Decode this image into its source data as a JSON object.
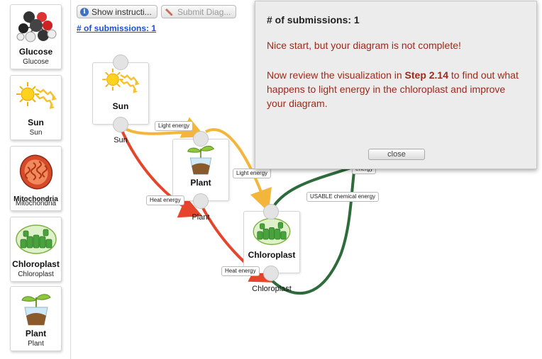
{
  "palette": {
    "items": [
      {
        "title": "Glucose",
        "subtitle": "Glucose"
      },
      {
        "title": "Sun",
        "subtitle": "Sun"
      },
      {
        "title": "Mitochondria",
        "subtitle": "Mitochondria"
      },
      {
        "title": "Chloroplast",
        "subtitle": "Chloroplast"
      },
      {
        "title": "Plant",
        "subtitle": "Plant"
      }
    ]
  },
  "toolbar": {
    "show_instructions_label": "Show instructi...",
    "submit_label": "Submit Diag...",
    "submissions_link": "# of submissions: 1"
  },
  "diagram": {
    "nodes": [
      {
        "title": "Sun",
        "caption": "Sun"
      },
      {
        "title": "Plant",
        "caption": "Plant"
      },
      {
        "title": "Chloroplast",
        "caption": "Chloroplast"
      }
    ],
    "edge_labels": [
      "Light energy",
      "Light energy",
      "Heat energy",
      "Heat energy",
      "USABLE chemical energy",
      "energy"
    ],
    "colors": {
      "light_energy": "#f3b53a",
      "heat_energy": "#e6452b",
      "chemical_energy": "#2e6b3a"
    }
  },
  "feedback": {
    "heading": "# of submissions: 1",
    "line1": "Nice start, but your diagram is not complete!",
    "line2_pre": "Now review the visualization in ",
    "line2_bold": "Step 2.14",
    "line2_post": " to find out what happens to light energy in the chloroplast and improve your diagram.",
    "close_label": "close"
  }
}
